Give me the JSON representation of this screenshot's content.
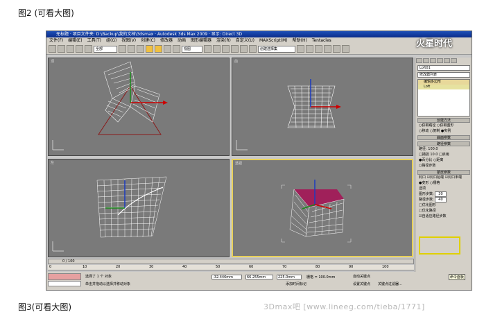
{
  "captions": {
    "top": "图2 (可看大图)",
    "bottom": "图3(可看大图)"
  },
  "watermark": "3Dmax吧 [www.lineeg.com/tieba/1771]",
  "logo": "火星时代",
  "window": {
    "title": "无标题 · 项目文件夹: D:\\Backup\\我的文档\\3dsmax · Autodesk 3ds Max 2009 · 显示: Direct 3D",
    "menu": [
      "文件(F)",
      "编辑(E)",
      "工具(T)",
      "组(G)",
      "视图(V)",
      "创建(C)",
      "修改器",
      "动画",
      "图形编辑器",
      "渲染(R)",
      "自定义(U)",
      "MAXScript(M)",
      "帮助(H)",
      "Tentacles"
    ],
    "toolbar": {
      "filter": "全部",
      "view": "视图",
      "selection": "创建选择集"
    }
  },
  "viewports": {
    "labels": [
      "顶",
      "前",
      "左",
      "透视"
    ]
  },
  "command_panel": {
    "name": "Loft01",
    "modifier_list": "修改器列表",
    "stack": [
      "编辑多边形",
      "Loft"
    ],
    "rollouts": {
      "creation": "创建方法",
      "creation_row1": "○获取路径  ○获取图形",
      "creation_row2": "○移动  ○复制  ●实例",
      "surface": "曲面参数",
      "path": "路径参数",
      "path_value": "路径: 100.0",
      "path_row1": "□捕捉  10.0  □启用",
      "path_row2": "●百分比  ○距离",
      "path_row3": "○路径步数",
      "skin": "蒙皮参数",
      "cap_row": "封口  ☑封口始端  ☑封口末端",
      "morph_row": "●变形  ○栅格",
      "options": "选项",
      "shape_steps_label": "图形步数:",
      "shape_steps_value": "30",
      "path_steps_label": "路径步数:",
      "path_steps_value": "40",
      "opt1": "□优化图形",
      "opt2": "□优化路径",
      "opt3": "☑自适应路径步数"
    }
  },
  "timeline": {
    "frame": "0 / 100",
    "ticks": [
      "0",
      "10",
      "20",
      "30",
      "40",
      "50",
      "60",
      "70",
      "80",
      "90",
      "100"
    ]
  },
  "status": {
    "selected": "选择了 1 个 对象",
    "hint": "单击并拖动以选择并移动对象",
    "x": "-32.446mm",
    "y": "66.255mm",
    "z": "225.0mm",
    "grid": "栅格 = 100.0mm",
    "addtime": "添加时间标记",
    "autokey": "自动关键点",
    "setkey": "设置关键点",
    "keyfilter": "关键点过滤器...",
    "cmd": "命令面板"
  }
}
